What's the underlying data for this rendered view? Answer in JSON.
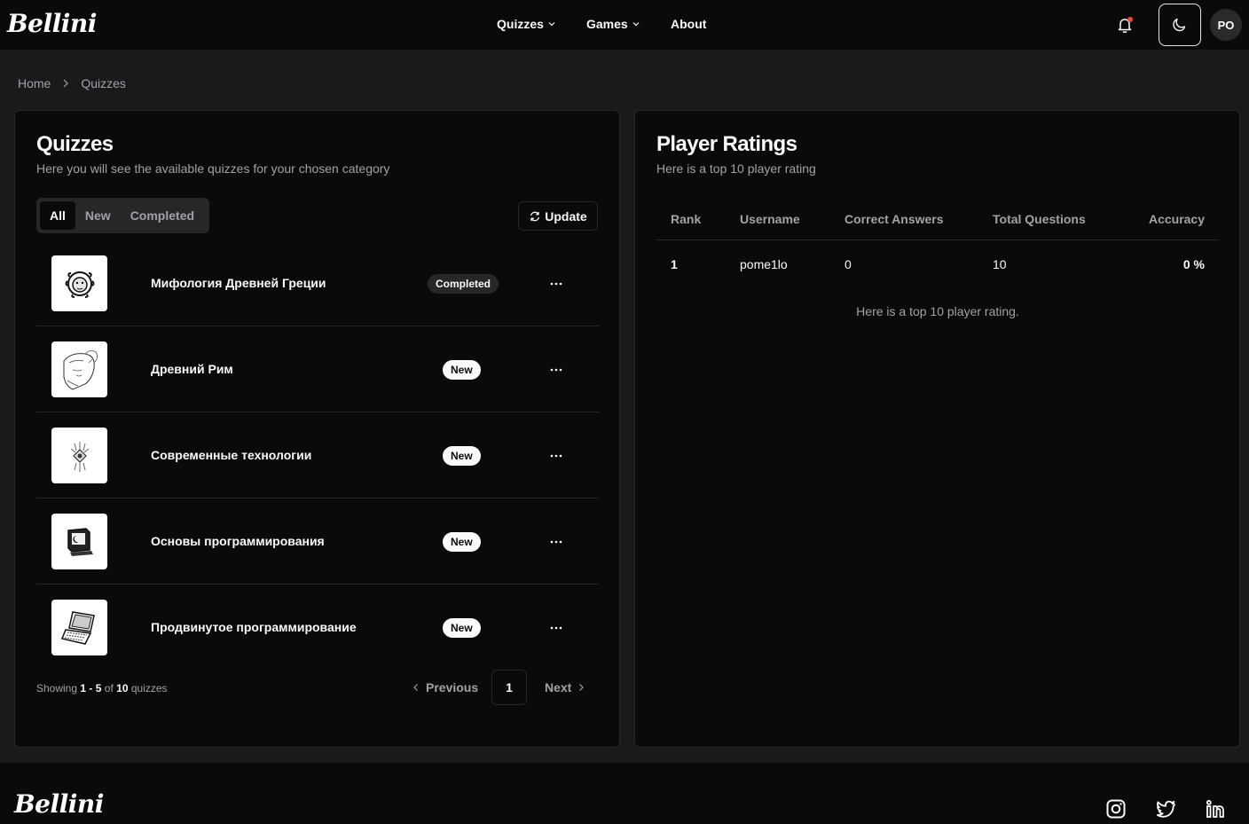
{
  "header": {
    "logo": "Bellini",
    "nav": [
      {
        "label": "Quizzes",
        "dropdown": true
      },
      {
        "label": "Games",
        "dropdown": true
      },
      {
        "label": "About",
        "dropdown": false
      }
    ],
    "avatar_initials": "PO",
    "notification_dot_color": "#ef4444"
  },
  "breadcrumb": [
    "Home",
    "Quizzes"
  ],
  "quizzes": {
    "title": "Quizzes",
    "subtitle": "Here you will see the available quizzes for your chosen category",
    "tabs": [
      "All",
      "New",
      "Completed"
    ],
    "active_tab": "All",
    "update_label": "Update",
    "items": [
      {
        "name": "Мифология Древней Греции",
        "status": "Completed",
        "icon": "medusa-icon"
      },
      {
        "name": "Древний Рим",
        "status": "New",
        "icon": "roman-statue-icon"
      },
      {
        "name": "Современные технологии",
        "status": "New",
        "icon": "circuit-icon"
      },
      {
        "name": "Основы программирования",
        "status": "New",
        "icon": "retro-computer-icon"
      },
      {
        "name": "Продвинутое программирование",
        "status": "New",
        "icon": "laptop-icon"
      }
    ],
    "showing": {
      "prefix": "Showing",
      "from": "1",
      "dash": "-",
      "to": "5",
      "of": "of",
      "total": "10",
      "suffix": "quizzes"
    },
    "pagination": {
      "previous": "Previous",
      "current": "1",
      "next": "Next"
    }
  },
  "ratings": {
    "title": "Player Ratings",
    "subtitle": "Here is a top 10 player rating",
    "columns": [
      "Rank",
      "Username",
      "Correct Answers",
      "Total Questions",
      "Accuracy"
    ],
    "rows": [
      {
        "rank": "1",
        "username": "pome1lo",
        "correct": "0",
        "total": "10",
        "accuracy": "0 %"
      }
    ],
    "caption": "Here is a top 10 player rating."
  },
  "footer": {
    "logo": "Bellini",
    "social": [
      "instagram-icon",
      "twitter-icon",
      "linkedin-icon"
    ]
  }
}
